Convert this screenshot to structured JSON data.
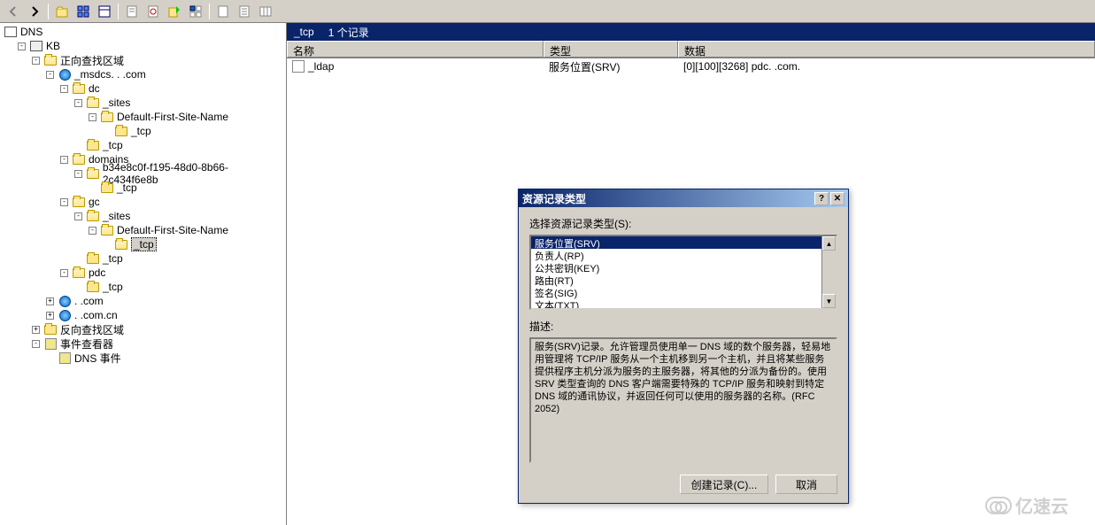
{
  "toolbar": {
    "icons": [
      "back-icon",
      "forward-icon",
      "up-icon",
      "view-icon",
      "detail-icon",
      "properties-icon",
      "refresh-icon",
      "export-icon",
      "help-icon",
      "grid-icon",
      "list-icon",
      "column-icon",
      "preview-icon"
    ]
  },
  "tree": {
    "root": "DNS",
    "server": "KB",
    "fwd_zone": "正向查找区域",
    "msdcs": "_msdcs. . .com",
    "dc": "dc",
    "sites": "_sites",
    "default_site": "Default-First-Site-Name",
    "tcp": "_tcp",
    "domains": "domains",
    "guid": "b34e8c0f-f195-48d0-8b66-2c434f6e8b",
    "gc": "gc",
    "pdc": "pdc",
    "dom1": ". .com",
    "dom2": ". .com.cn",
    "rev_zone": "反向查找区域",
    "evt_viewer": "事件查看器",
    "dns_evt": "DNS 事件"
  },
  "right": {
    "path": "_tcp",
    "count": "1 个记录",
    "columns": {
      "name": "名称",
      "type": "类型",
      "data": "数据"
    },
    "rows": [
      {
        "name": "_ldap",
        "type": "服务位置(SRV)",
        "data": "[0][100][3268] pdc. .com."
      }
    ]
  },
  "dialog": {
    "title": "资源记录类型",
    "select_label": "选择资源记录类型(S):",
    "options": [
      "服务位置(SRV)",
      "负责人(RP)",
      "公共密钥(KEY)",
      "路由(RT)",
      "签名(SIG)",
      "文本(TXT)"
    ],
    "selected_index": 0,
    "desc_label": "描述:",
    "description": "服务(SRV)记录。允许管理员使用单一 DNS 域的数个服务器，轻易地用管理将 TCP/IP 服务从一个主机移到另一个主机，并且将某些服务提供程序主机分派为服务的主服务器，将其他的分派为备份的。使用 SRV 类型查询的 DNS 客户端需要特殊的 TCP/IP 服务和映射到特定 DNS 域的通讯协议，并返回任何可以使用的服务器的名称。(RFC 2052)",
    "create_btn": "创建记录(C)...",
    "cancel_btn": "取消"
  },
  "watermark": "亿速云"
}
